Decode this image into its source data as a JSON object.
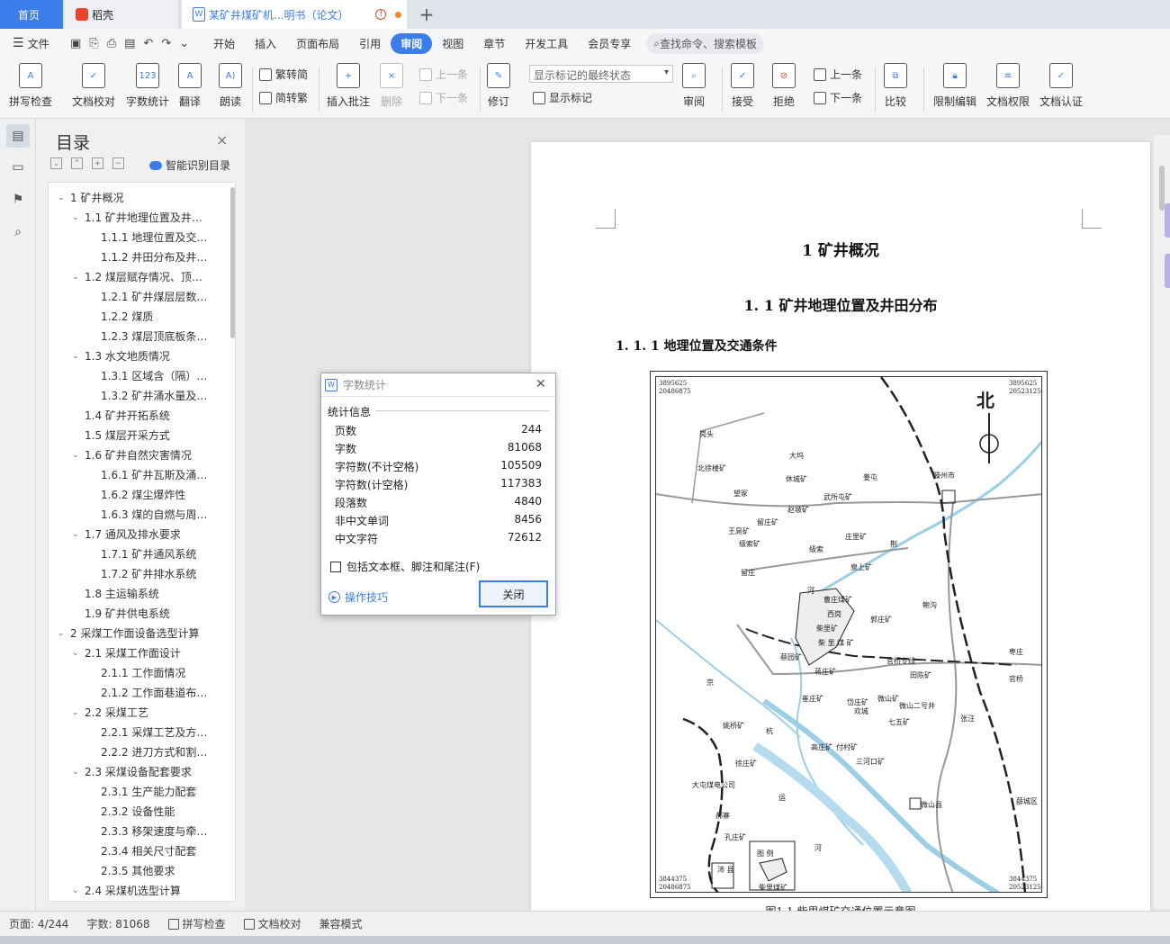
{
  "tabs": {
    "home": "首页",
    "daoke": "稻壳",
    "doc": "某矿井煤矿机...明书（论文）"
  },
  "menubar": {
    "file": "文件",
    "items": [
      "开始",
      "插入",
      "页面布局",
      "引用",
      "审阅",
      "视图",
      "章节",
      "开发工具",
      "会员专享"
    ],
    "active": "审阅",
    "search": "查找命令、搜索模板"
  },
  "ribbon": {
    "spellcheck": "拼写检查",
    "doc_proof": "文档校对",
    "word_count": "字数统计",
    "translate": "翻译",
    "read_aloud": "朗读",
    "trad_to_simp": "繁转简",
    "simp_to_trad": "简转繁",
    "insert_comment": "插入批注",
    "delete": "删除",
    "prev_comment": "上一条",
    "next_comment": "下一条",
    "track": "修订",
    "markup_state": "显示标记的最终状态",
    "show_markup": "显示标记",
    "review": "审阅",
    "accept": "接受",
    "reject": "拒绝",
    "prev_change": "上一条",
    "next_change": "下一条",
    "compare": "比较",
    "restrict": "限制编辑",
    "permission": "文档权限",
    "certify": "文档认证"
  },
  "toc": {
    "title": "目录",
    "smart": "智能识别目录",
    "items": [
      {
        "text": "1 矿井概况",
        "level": 1,
        "caret": "v"
      },
      {
        "text": "1.1 矿井地理位置及井…",
        "level": 2,
        "caret": "v"
      },
      {
        "text": "1.1.1 地理位置及交…",
        "level": 3,
        "caret": ""
      },
      {
        "text": "1.1.2 井田分布及井…",
        "level": 3,
        "caret": ""
      },
      {
        "text": "1.2 煤层赋存情况、顶…",
        "level": 2,
        "caret": "v"
      },
      {
        "text": "1.2.1 矿井煤层层数…",
        "level": 3,
        "caret": ""
      },
      {
        "text": "1.2.2 煤质",
        "level": 3,
        "caret": ""
      },
      {
        "text": "1.2.3 煤层顶底板条…",
        "level": 3,
        "caret": ""
      },
      {
        "text": "1.3 水文地质情况",
        "level": 2,
        "caret": "v"
      },
      {
        "text": "1.3.1 区域含（隔）…",
        "level": 3,
        "caret": ""
      },
      {
        "text": "1.3.2 矿井涌水量及…",
        "level": 3,
        "caret": ""
      },
      {
        "text": "1.4 矿井开拓系统",
        "level": 2,
        "caret": ""
      },
      {
        "text": "1.5 煤层开采方式",
        "level": 2,
        "caret": ""
      },
      {
        "text": "1.6 矿井自然灾害情况",
        "level": 2,
        "caret": "v"
      },
      {
        "text": "1.6.1 矿井瓦斯及涌…",
        "level": 3,
        "caret": ""
      },
      {
        "text": "1.6.2 煤尘爆炸性",
        "level": 3,
        "caret": ""
      },
      {
        "text": "1.6.3 煤的自燃与周…",
        "level": 3,
        "caret": ""
      },
      {
        "text": "1.7 通风及排水要求",
        "level": 2,
        "caret": "v"
      },
      {
        "text": "1.7.1 矿井通风系统",
        "level": 3,
        "caret": ""
      },
      {
        "text": "1.7.2 矿井排水系统",
        "level": 3,
        "caret": ""
      },
      {
        "text": "1.8 主运输系统",
        "level": 2,
        "caret": ""
      },
      {
        "text": "1.9 矿井供电系统",
        "level": 2,
        "caret": ""
      },
      {
        "text": "2 采煤工作面设备选型计算",
        "level": 1,
        "caret": "v"
      },
      {
        "text": "2.1 采煤工作面设计",
        "level": 2,
        "caret": "v"
      },
      {
        "text": "2.1.1 工作面情况",
        "level": 3,
        "caret": ""
      },
      {
        "text": "2.1.2 工作面巷道布…",
        "level": 3,
        "caret": ""
      },
      {
        "text": "2.2  采煤工艺",
        "level": 2,
        "caret": "v"
      },
      {
        "text": "2.2.1 采煤工艺及方…",
        "level": 3,
        "caret": ""
      },
      {
        "text": "2.2.2 进刀方式和割…",
        "level": 3,
        "caret": ""
      },
      {
        "text": "2.3 采煤设备配套要求",
        "level": 2,
        "caret": "v"
      },
      {
        "text": "2.3.1 生产能力配套",
        "level": 3,
        "caret": ""
      },
      {
        "text": "2.3.2 设备性能",
        "level": 3,
        "caret": ""
      },
      {
        "text": "2.3.3 移架速度与牵…",
        "level": 3,
        "caret": ""
      },
      {
        "text": "2.3.4 相关尺寸配套",
        "level": 3,
        "caret": ""
      },
      {
        "text": "2.3.5 其他要求",
        "level": 3,
        "caret": ""
      },
      {
        "text": "2.4  采煤机选型计算",
        "level": 2,
        "caret": "v"
      }
    ]
  },
  "document": {
    "h1": "1 矿井概况",
    "h2": "1. 1 矿井地理位置及井田分布",
    "h3": "1. 1. 1 地理位置及交通条件",
    "caption": "图1.1  柴里煤矿交通位置示意图",
    "map": {
      "north": "北",
      "coord_tl": [
        "3895625",
        "20486875"
      ],
      "coord_tr": [
        "3895625",
        "20523125"
      ],
      "coord_bl": [
        "3844375",
        "20486875"
      ],
      "coord_br": [
        "3844375",
        "20523125"
      ],
      "places": [
        "岗头",
        "大坞",
        "北徐楼矿",
        "休城矿",
        "姜屯",
        "滕州市",
        "望冢",
        "武所屯矿",
        "赵坡矿",
        "留庄矿",
        "王晁矿",
        "级索矿",
        "级索",
        "庄里矿",
        "荆",
        "泉上矿",
        "留庄",
        "河",
        "曹庄煤矿",
        "西岗",
        "鲍沟",
        "郭庄矿",
        "柴里矿",
        "柴  里  煤  矿",
        "蔡园矿",
        "官桥专线",
        "蒋庄矿",
        "田陈矿",
        "官桥",
        "枣庄",
        "京",
        "崔庄矿",
        "岱庄矿",
        "微山矿",
        "微山二号井",
        "欢城",
        "七五矿",
        "张汪",
        "姚桥矿",
        "杭",
        "高庄矿",
        "付村矿",
        "三河口矿",
        "徐庄矿",
        "大屯煤电公司",
        "运",
        "微山县",
        "薛城区",
        "郝寨",
        "孔庄矿",
        "河",
        "图  例",
        "柴里煤矿",
        "沛  县"
      ]
    }
  },
  "dialog": {
    "title": "字数统计",
    "section": "统计信息",
    "stats": [
      {
        "label": "页数",
        "value": "244"
      },
      {
        "label": "字数",
        "value": "81068"
      },
      {
        "label": "字符数(不计空格)",
        "value": "105509"
      },
      {
        "label": "字符数(计空格)",
        "value": "117383"
      },
      {
        "label": "段落数",
        "value": "4840"
      },
      {
        "label": "非中文单词",
        "value": "8456"
      },
      {
        "label": "中文字符",
        "value": "72612"
      }
    ],
    "checkbox": "包括文本框、脚注和尾注(F)",
    "tips": "操作技巧",
    "close": "关闭"
  },
  "status": {
    "page": "页面: 4/244",
    "words": "字数: 81068",
    "spell": "拼写检查",
    "proof": "文档校对",
    "compat": "兼容模式"
  }
}
